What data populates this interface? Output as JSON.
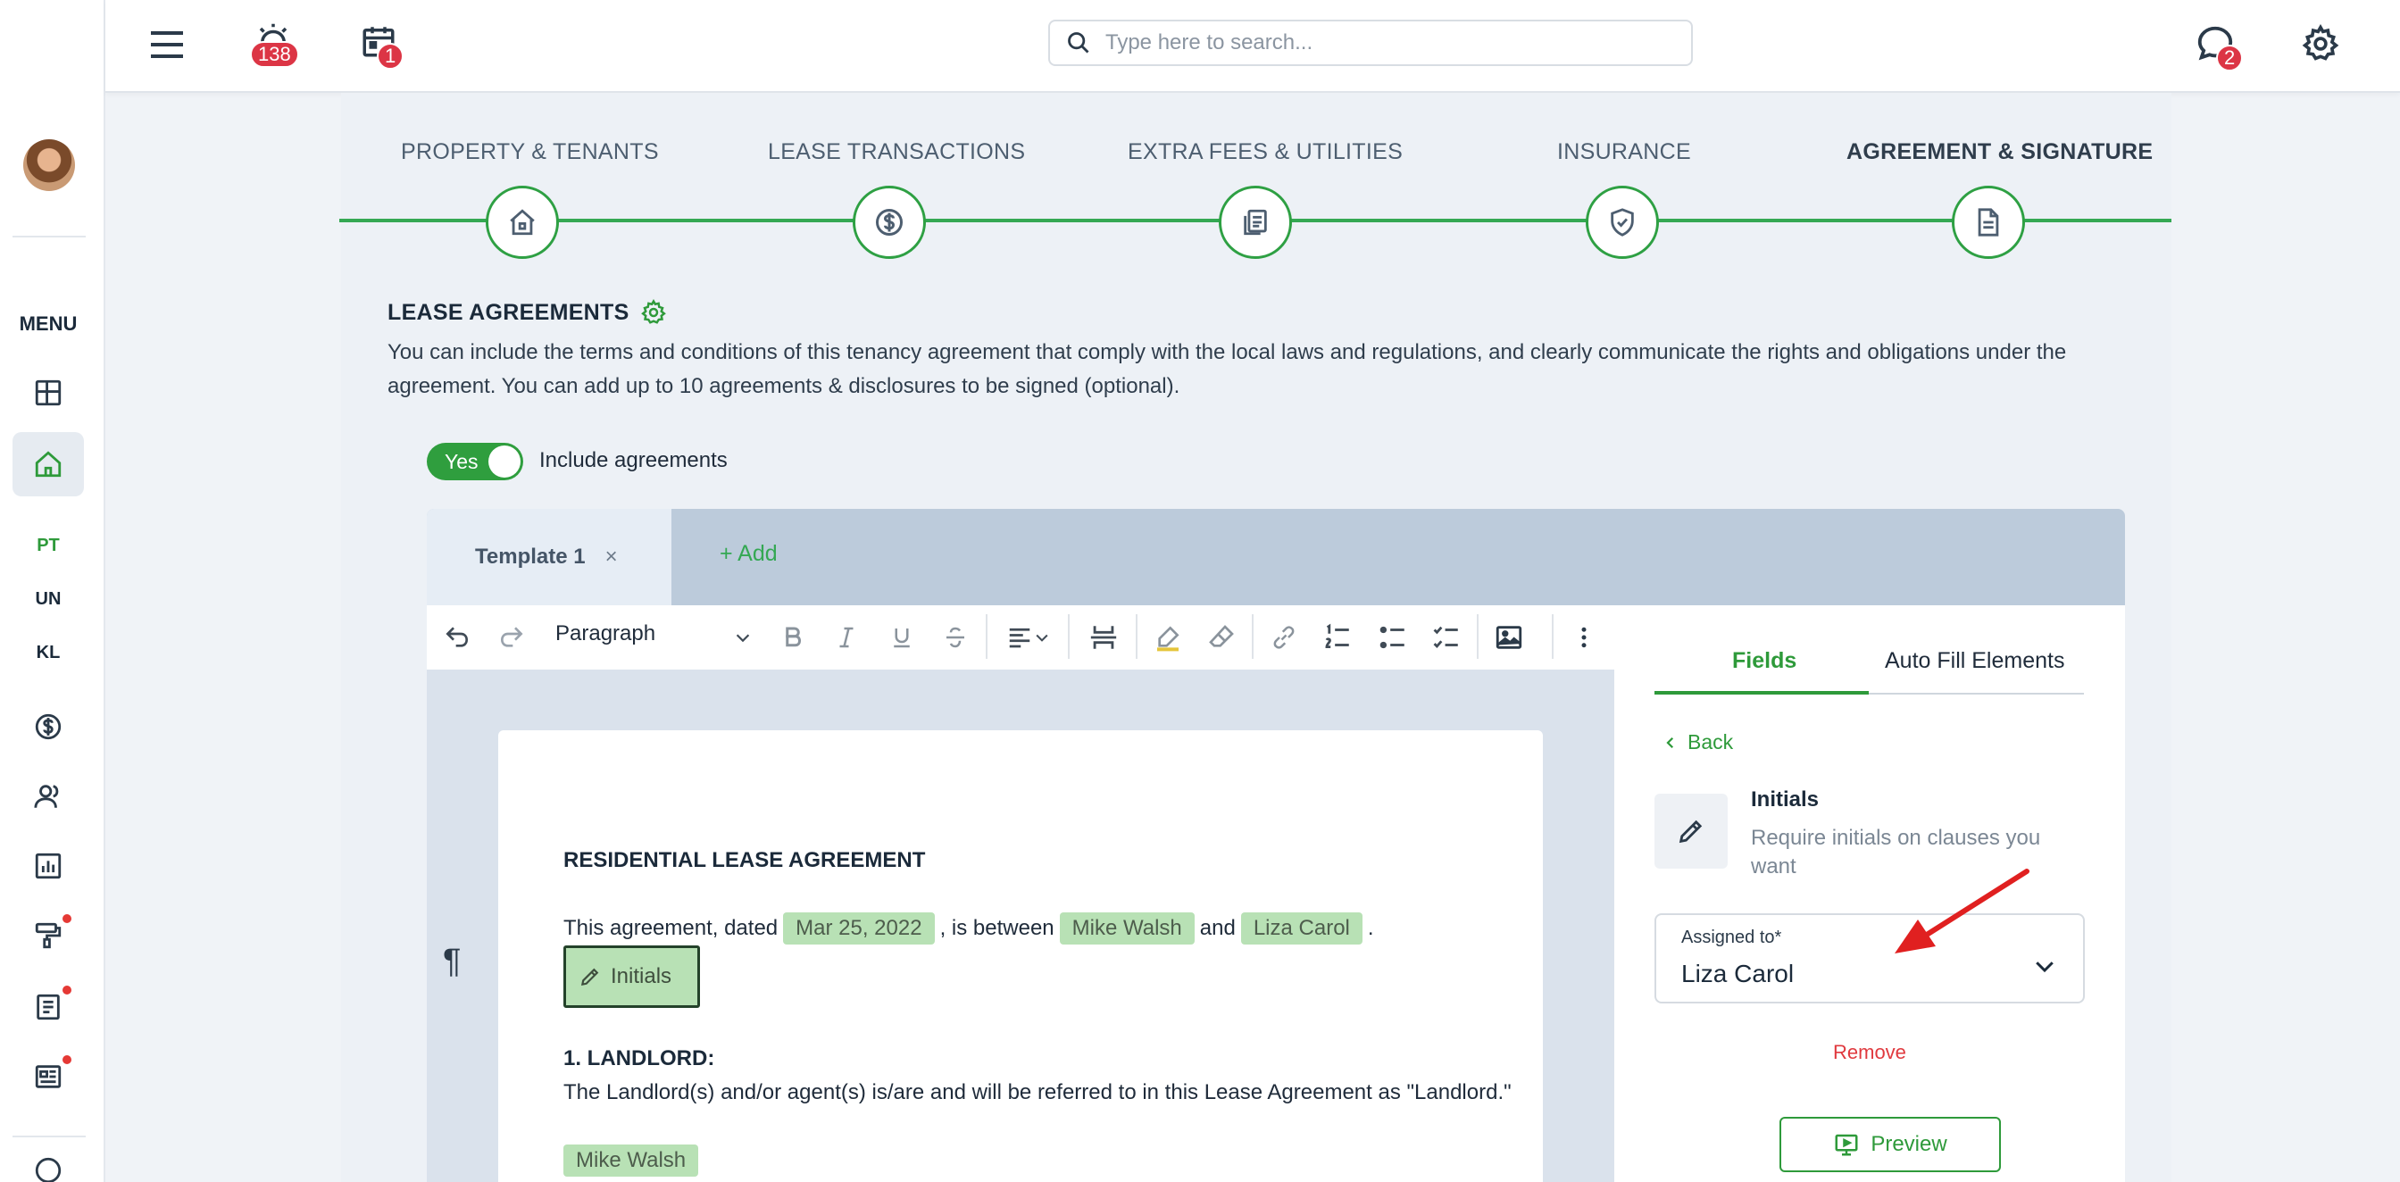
{
  "topbar": {
    "alarm_badge": "138",
    "calendar_badge": "1",
    "chat_badge": "2",
    "search_placeholder": "Type here to search..."
  },
  "sidebar": {
    "menu_label": "MENU",
    "abbreviations": [
      "PT",
      "UN",
      "KL"
    ]
  },
  "steps": [
    {
      "label": "PROPERTY & TENANTS",
      "icon": "house-icon"
    },
    {
      "label": "LEASE TRANSACTIONS",
      "icon": "dollar-icon"
    },
    {
      "label": "EXTRA FEES & UTILITIES",
      "icon": "documents-dollar-icon"
    },
    {
      "label": "INSURANCE",
      "icon": "shield-check-icon"
    },
    {
      "label": "AGREEMENT & SIGNATURE",
      "icon": "document-icon"
    }
  ],
  "section": {
    "title": "LEASE AGREEMENTS",
    "description": "You can include the terms and conditions of this tenancy agreement that comply with the local laws and regulations, and clearly communicate the rights and obligations under the agreement. You can add up to 10 agreements & disclosures to be signed (optional).",
    "toggle_label": "Yes",
    "toggle_text": "Include agreements"
  },
  "tabs": {
    "active": "Template 1",
    "close": "×",
    "add": "+ Add"
  },
  "editor": {
    "block_style": "Paragraph",
    "pilcrow": "¶"
  },
  "document": {
    "title": "RESIDENTIAL LEASE AGREEMENT",
    "line_prefix": "This agreement, dated",
    "date": "Mar 25, 2022",
    "between": ", is between",
    "landlord": "Mike Walsh",
    "and": "and",
    "tenant": "Liza Carol",
    "period": ".",
    "initials": "Initials",
    "section1_title": "1. LANDLORD:",
    "section1_text": "The Landlord(s) and/or agent(s) is/are and will be referred to in this Lease Agreement as \"Landlord.\"",
    "landlord_chip": "Mike Walsh"
  },
  "panel": {
    "tab_fields": "Fields",
    "tab_auto": "Auto Fill Elements",
    "back": "Back",
    "field_name": "Initials",
    "field_desc": "Require initials on clauses you want",
    "assigned_label": "Assigned to*",
    "assigned_value": "Liza Carol",
    "remove": "Remove",
    "preview": "Preview"
  },
  "colors": {
    "accent_green": "#2e9a3a",
    "badge_red": "#dc3545",
    "chip_green": "#b8e1b5"
  }
}
